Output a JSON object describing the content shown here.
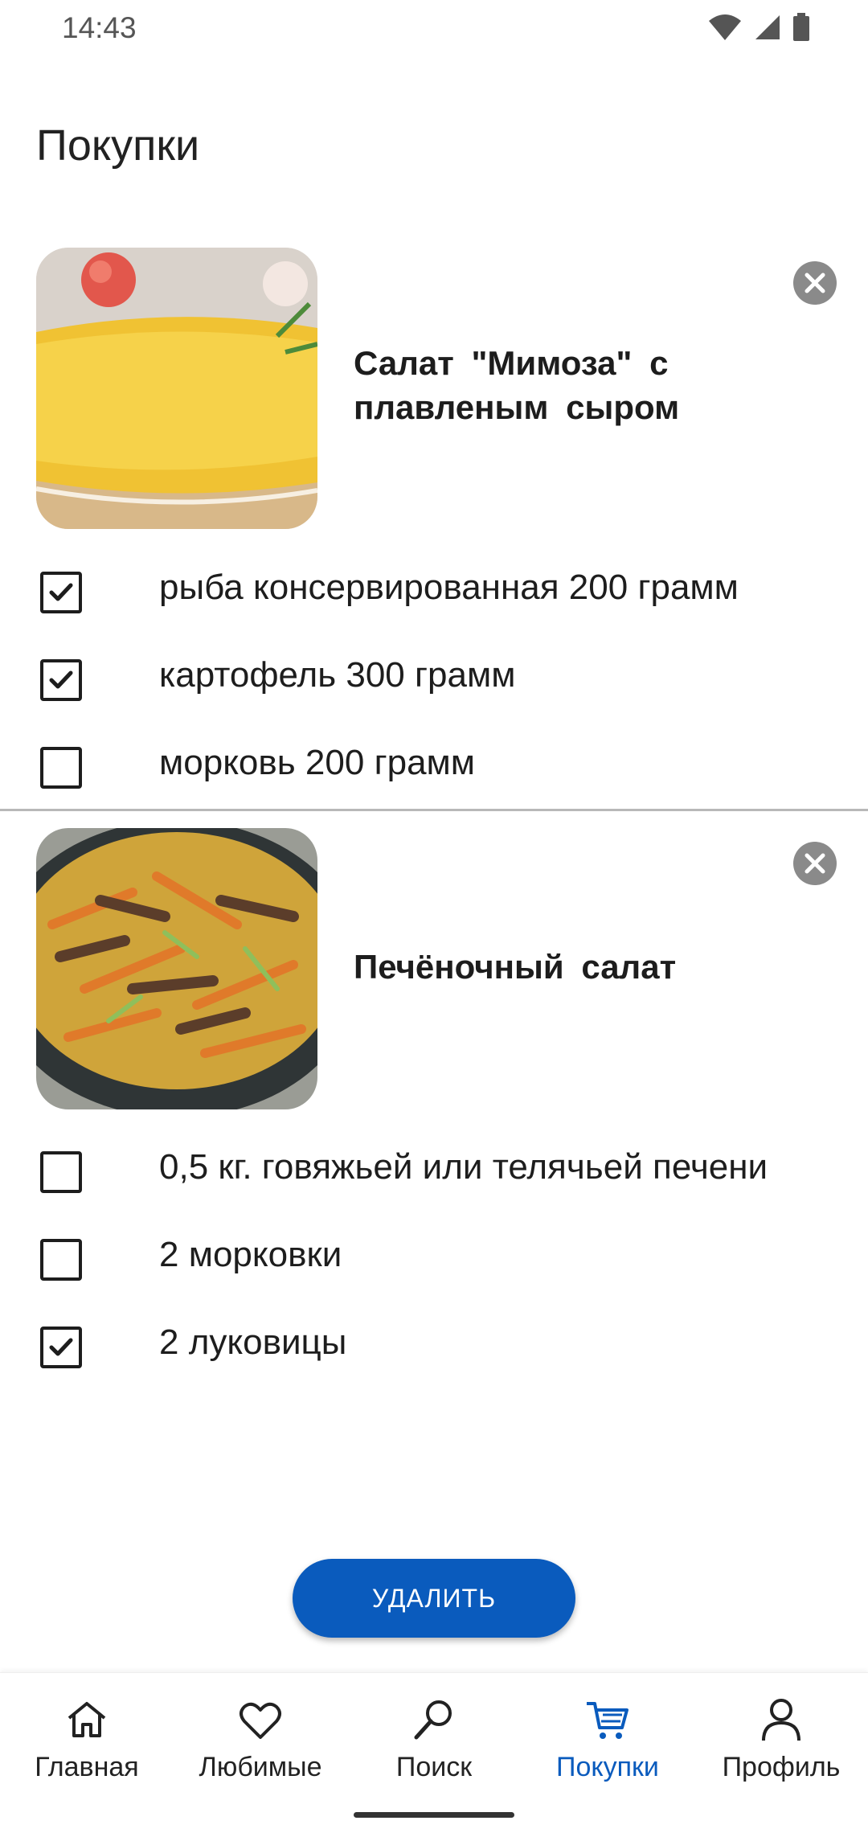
{
  "status": {
    "time": "14:43"
  },
  "page": {
    "title": "Покупки"
  },
  "recipes": [
    {
      "title": "Салат \"Мимоза\" с плавленым сыром",
      "ingredients": [
        {
          "label": "рыба консервированная 200 грамм",
          "checked": true
        },
        {
          "label": "картофель 300 грамм",
          "checked": true
        },
        {
          "label": "морковь 200 грамм",
          "checked": false
        }
      ]
    },
    {
      "title": "Печёночный салат",
      "ingredients": [
        {
          "label": "0,5 кг. говяжьей или телячьей печени",
          "checked": false
        },
        {
          "label": "2 морковки",
          "checked": false
        },
        {
          "label": "2 луковицы",
          "checked": true
        }
      ]
    }
  ],
  "actions": {
    "delete_label": "УДАЛИТЬ"
  },
  "nav": {
    "items": [
      {
        "label": "Главная",
        "icon": "home-icon"
      },
      {
        "label": "Любимые",
        "icon": "heart-icon"
      },
      {
        "label": "Поиск",
        "icon": "search-icon"
      },
      {
        "label": "Покупки",
        "icon": "cart-icon",
        "active": true
      },
      {
        "label": "Профиль",
        "icon": "person-icon"
      }
    ]
  },
  "colors": {
    "accent": "#0a5bbd",
    "remove_button": "#8a8a8a",
    "text": "#1d1d1d"
  }
}
